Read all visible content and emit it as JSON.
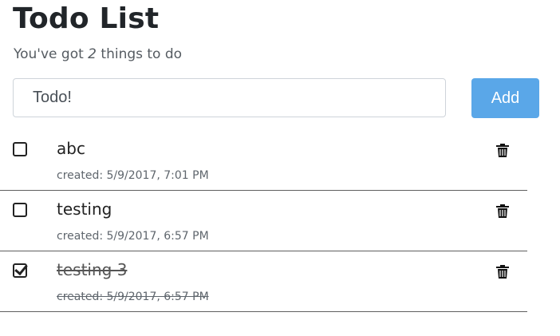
{
  "header": {
    "title": "Todo List",
    "summary_prefix": "You've got",
    "summary_count": "2",
    "summary_suffix": "things to do"
  },
  "form": {
    "placeholder": "Todo!",
    "value": "",
    "add_label": "Add"
  },
  "todos": [
    {
      "text": "abc",
      "created": "created: 5/9/2017, 7:01 PM",
      "completed": false,
      "delete_icon": "trash-icon"
    },
    {
      "text": "testing",
      "created": "created: 5/9/2017, 6:57 PM",
      "completed": false,
      "delete_icon": "trash-icon"
    },
    {
      "text": "testing 3",
      "created": "created: 5/9/2017, 6:57 PM",
      "completed": true,
      "delete_icon": "trash-icon"
    }
  ],
  "colors": {
    "accent": "#5aa7e8",
    "text": "#212529",
    "divider": "#5f5f5f"
  }
}
